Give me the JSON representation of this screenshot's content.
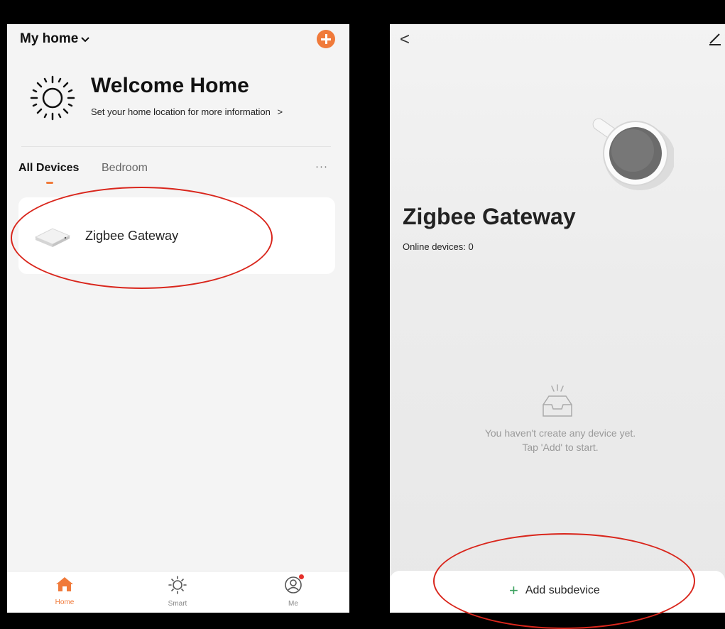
{
  "left": {
    "home_title": "My home",
    "welcome": {
      "title": "Welcome Home",
      "subtitle": "Set your home location for more information",
      "subtitle_chevron": ">"
    },
    "tabs": [
      {
        "label": "All Devices",
        "active": true
      },
      {
        "label": "Bedroom",
        "active": false
      }
    ],
    "more_label": "···",
    "devices": [
      {
        "name": "Zigbee Gateway"
      }
    ],
    "tabbar": [
      {
        "label": "Home",
        "active": true,
        "icon": "home-icon"
      },
      {
        "label": "Smart",
        "active": false,
        "icon": "sun-icon"
      },
      {
        "label": "Me",
        "active": false,
        "icon": "user-icon"
      }
    ]
  },
  "right": {
    "back_label": "<",
    "title": "Zigbee Gateway",
    "online": "Online devices: 0",
    "empty_line1": "You haven't create any device yet.",
    "empty_line2": "Tap 'Add' to start.",
    "add_plus": "+",
    "add_label": "Add subdevice"
  },
  "colors": {
    "accent": "#f07a3a",
    "highlight": "#d9261c",
    "add_plus": "#3aa15e"
  }
}
